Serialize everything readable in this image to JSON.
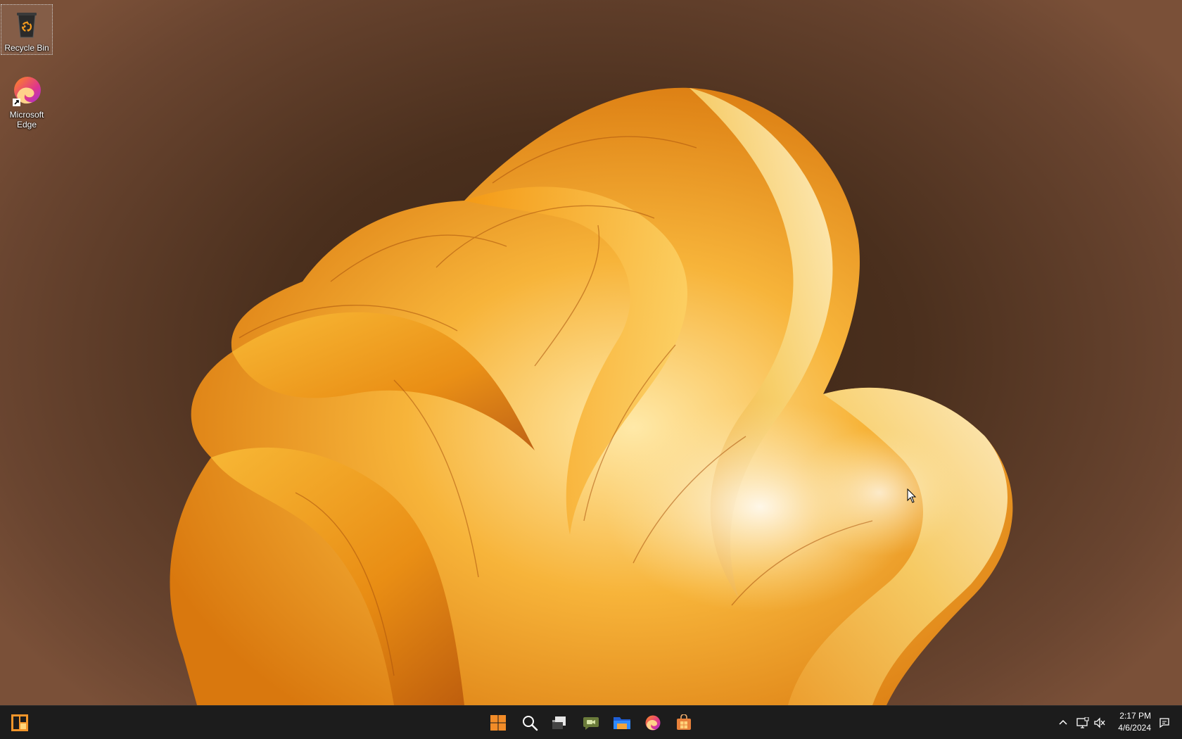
{
  "desktop": {
    "icons": [
      {
        "name": "recycle-bin",
        "label": "Recycle Bin",
        "icon": "recycle-bin-icon",
        "selected": true
      },
      {
        "name": "microsoft-edge",
        "label": "Microsoft Edge",
        "icon": "edge-icon",
        "shortcut": true
      }
    ]
  },
  "taskbar": {
    "widgets_icon": "widgets-icon",
    "pinned": [
      {
        "name": "start-button",
        "icon": "windows-icon"
      },
      {
        "name": "search-button",
        "icon": "search-icon"
      },
      {
        "name": "task-view-button",
        "icon": "task-view-icon"
      },
      {
        "name": "chat-button",
        "icon": "chat-icon"
      },
      {
        "name": "file-explorer-button",
        "icon": "folder-icon"
      },
      {
        "name": "edge-button",
        "icon": "edge-icon"
      },
      {
        "name": "store-button",
        "icon": "store-icon"
      }
    ],
    "tray": {
      "icons": [
        "chevron-up-icon",
        "network-icon",
        "volume-muted-icon",
        "notification-icon"
      ]
    },
    "clock": {
      "time": "2:17 PM",
      "date": "4/6/2024"
    }
  },
  "colors": {
    "accent": "#f5a623",
    "taskbar_bg": "#1c1c1c",
    "wallpaper_bg": "#4a2f1d"
  }
}
